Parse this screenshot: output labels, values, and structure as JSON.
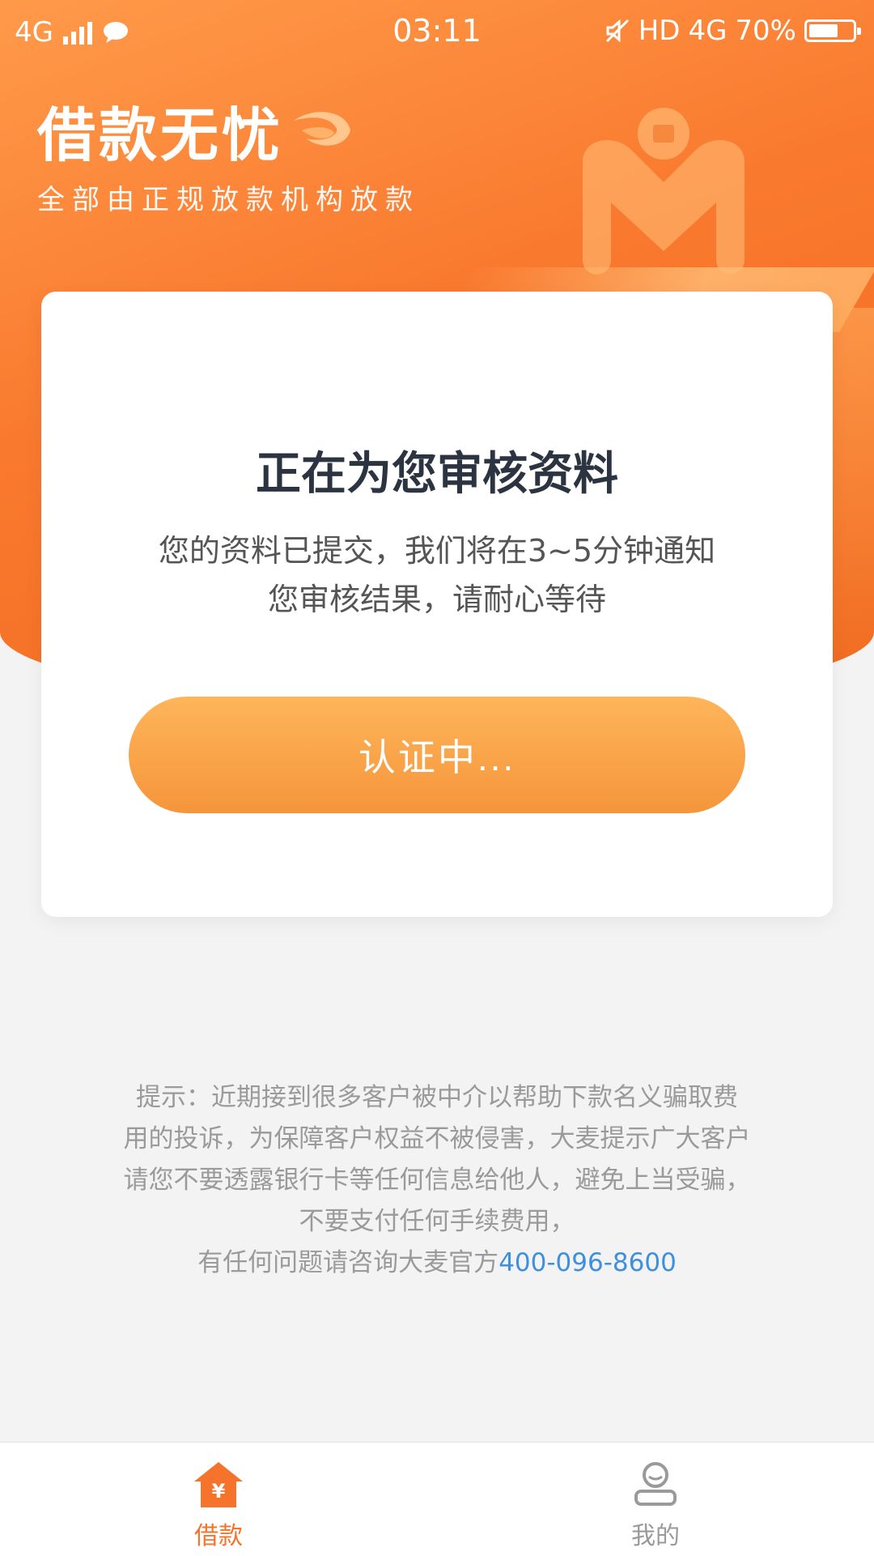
{
  "status_bar": {
    "network_left": "4G",
    "time": "03:11",
    "hd": "HD",
    "network_right": "4G",
    "battery": "70%",
    "battery_level": 0.7
  },
  "header": {
    "app_name": "借款无忧",
    "slogan": "全部由正规放款机构放款"
  },
  "card": {
    "title": "正在为您审核资料",
    "desc_line1": "您的资料已提交，我们将在3~5分钟通知",
    "desc_line2": "您审核结果，请耐心等待",
    "button_label": "认证中..."
  },
  "notice": {
    "line1": "提示：近期接到很多客户被中介以帮助下款名义骗取费",
    "line2": "用的投诉，为保障客户权益不被侵害，大麦提示广大客户",
    "line3": "请您不要透露银行卡等任何信息给他人，避免上当受骗，",
    "line4": "不要支付任何手续费用，",
    "line5_prefix": "有任何问题请咨询大麦官方",
    "phone": "400-096-8600"
  },
  "tabs": [
    {
      "label": "借款",
      "icon": "loan-home-icon",
      "active": true
    },
    {
      "label": "我的",
      "icon": "profile-icon",
      "active": false
    }
  ],
  "colors": {
    "brand_orange": "#f9792e",
    "button_orange": "#f5953b",
    "active_tab": "#f5732a",
    "link_blue": "#3d8fe0"
  }
}
